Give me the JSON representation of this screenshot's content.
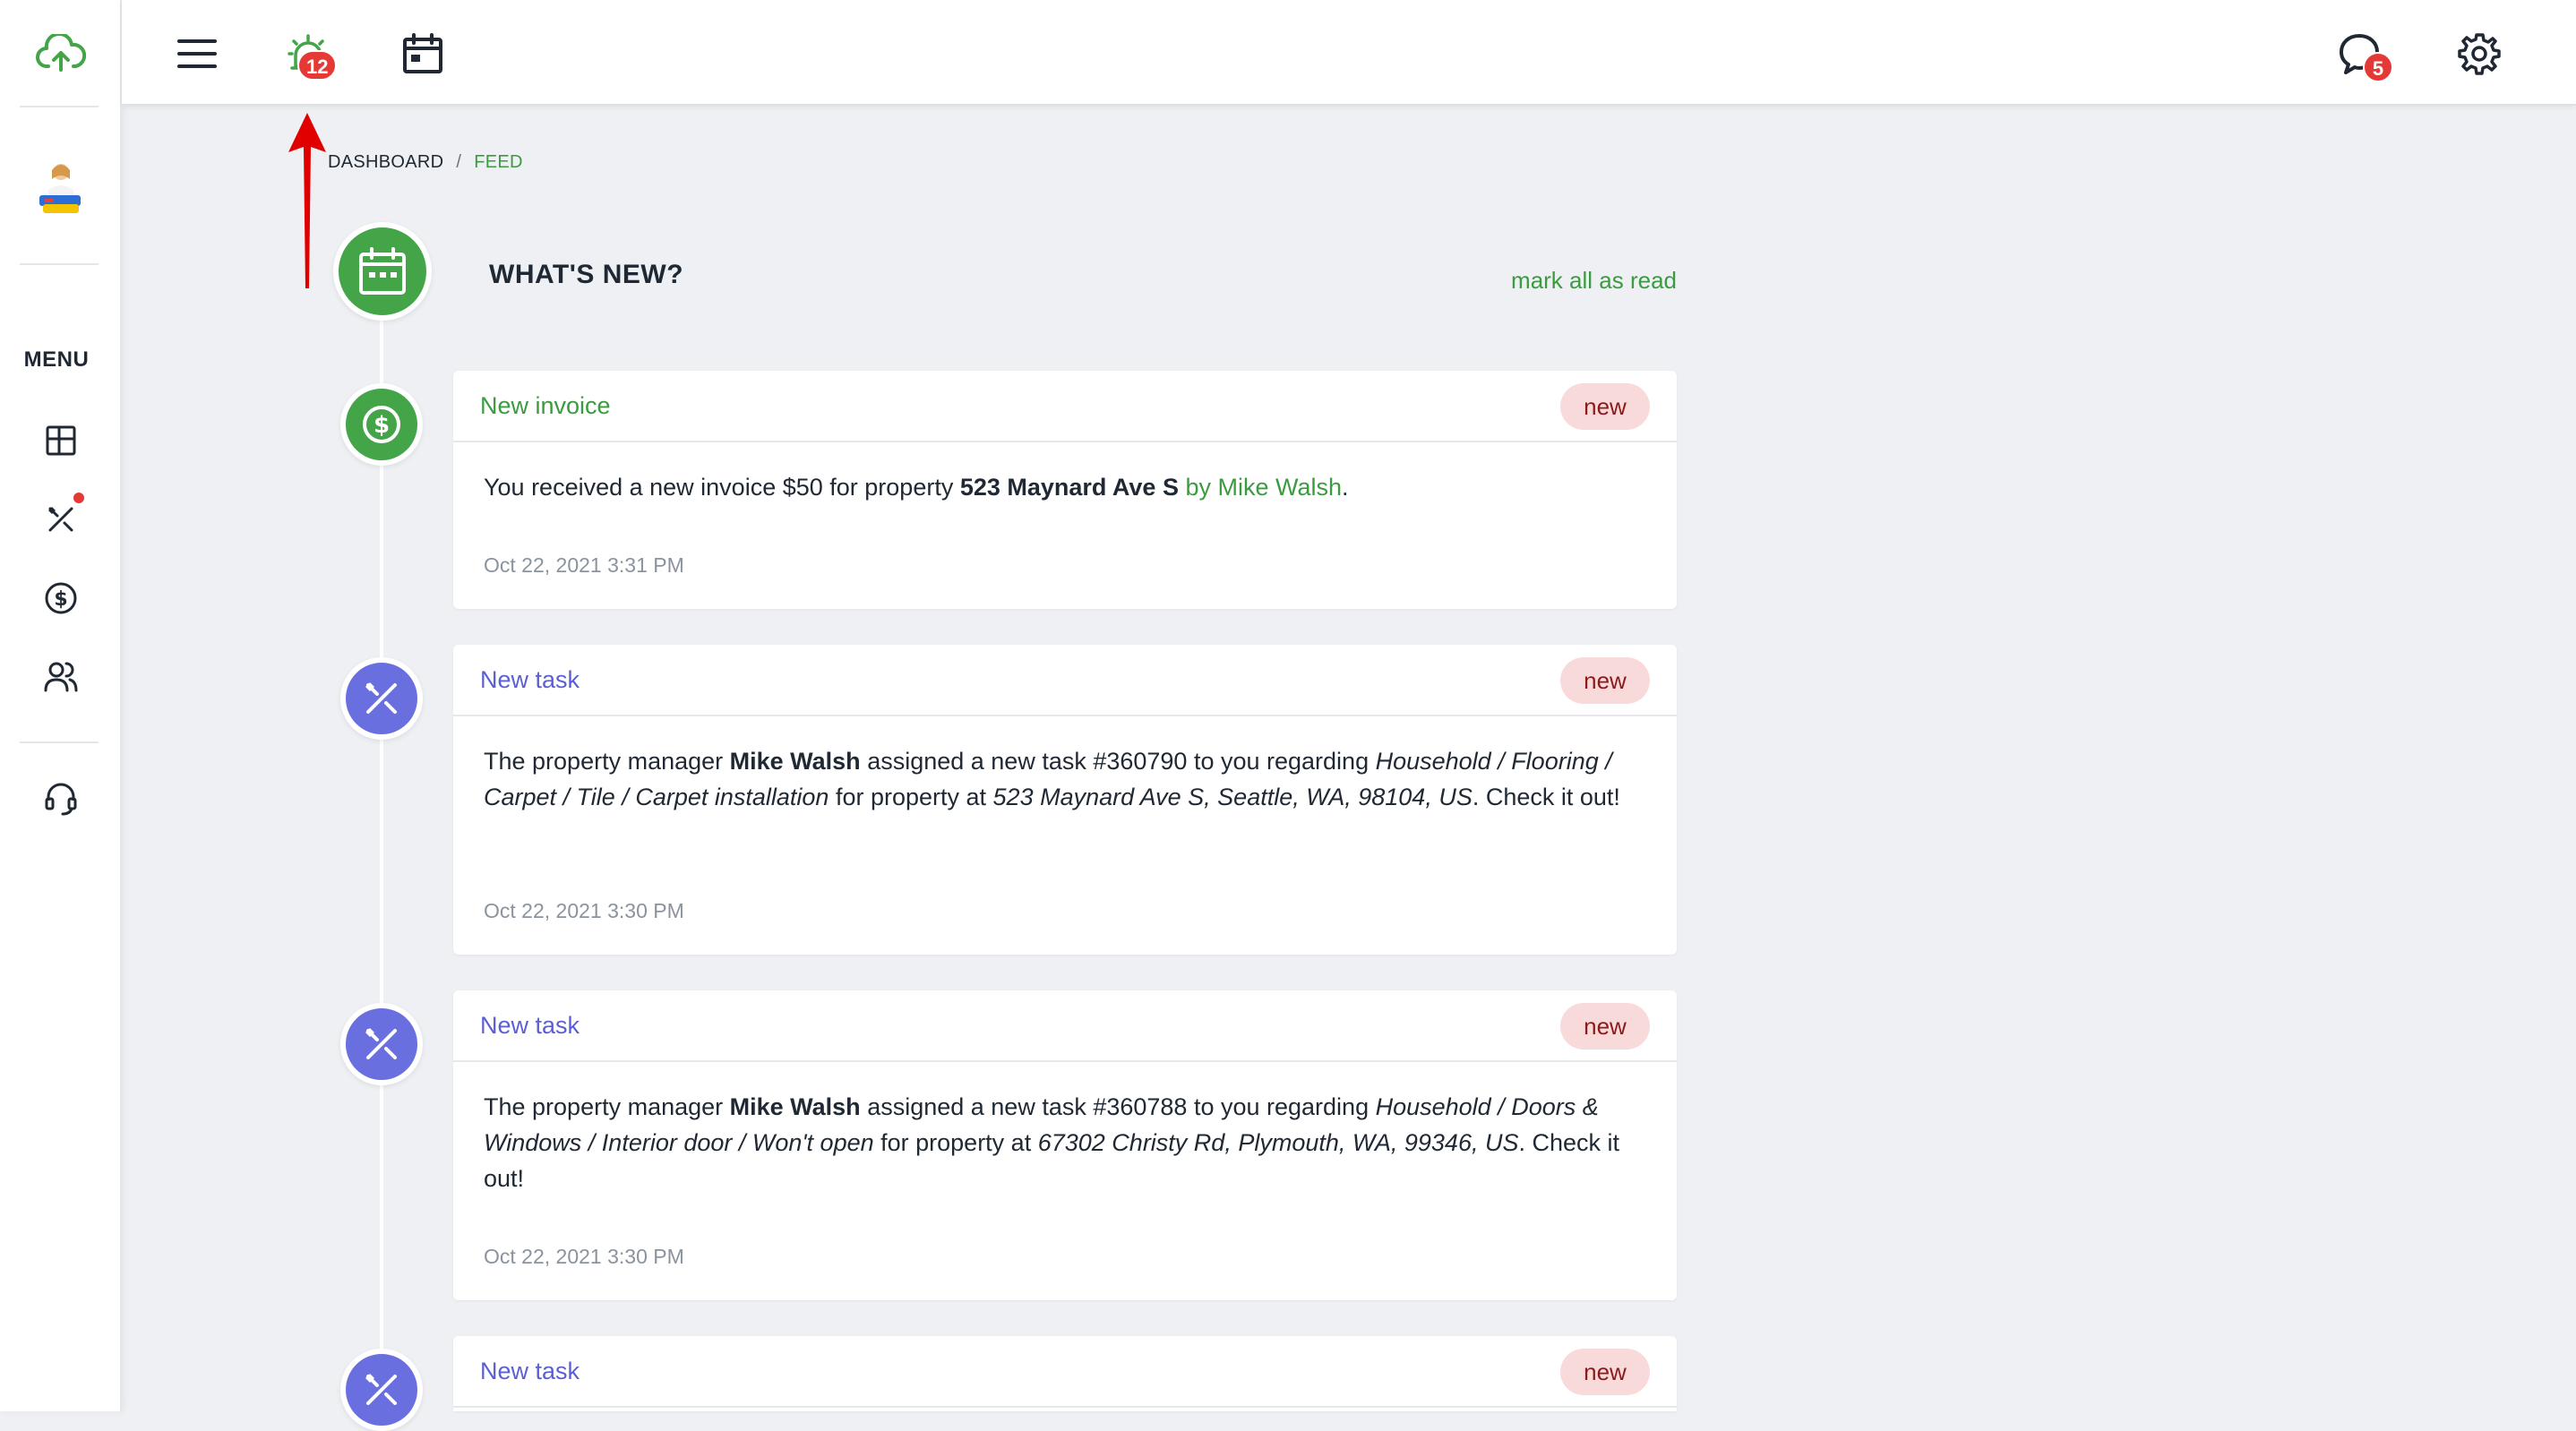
{
  "topbar": {
    "notifications_count": "12",
    "messages_count": "5"
  },
  "sidebar": {
    "menu_label": "MENU"
  },
  "breadcrumb": {
    "item_1": "DASHBOARD",
    "separator": "/",
    "item_2": "FEED"
  },
  "feed": {
    "title": "WHAT'S NEW?",
    "mark_all_label": "mark all as read",
    "items": [
      {
        "type": "invoice",
        "title": "New invoice",
        "badge": "new",
        "text_1": "You received a new invoice $50 for property ",
        "property": "523 Maynard Ave S",
        "by_label": "by Mike Walsh",
        "end": ".",
        "time": "Oct 22, 2021 3:31 PM"
      },
      {
        "type": "task",
        "title": "New task",
        "badge": "new",
        "text_1": "The property manager ",
        "manager": "Mike Walsh",
        "text_2": " assigned a new task #360790 to you regarding ",
        "category": "Household / Flooring / Carpet / Tile / Carpet installation",
        "text_3": " for property at ",
        "address": "523 Maynard Ave S, Seattle, WA, 98104, US",
        "text_4": ". Check it out!",
        "time": "Oct 22, 2021 3:30 PM"
      },
      {
        "type": "task",
        "title": "New task",
        "badge": "new",
        "text_1": "The property manager ",
        "manager": "Mike Walsh",
        "text_2": " assigned a new task #360788 to you regarding ",
        "category": "Household / Doors & Windows / Interior door / Won't open",
        "text_3": " for property at ",
        "address": "67302 Christy Rd, Plymouth, WA, 99346, US",
        "text_4": ". Check it out!",
        "time": "Oct 22, 2021 3:30 PM"
      },
      {
        "type": "task",
        "title": "New task",
        "badge": "new"
      }
    ]
  },
  "colors": {
    "accent_green": "#43a547",
    "accent_purple": "#6a6fe0",
    "badge_red": "#e53935",
    "pill_bg": "#f9dada"
  }
}
